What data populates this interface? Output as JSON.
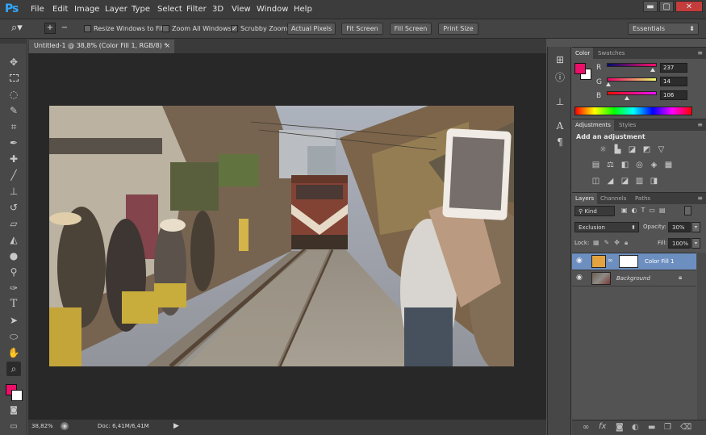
{
  "app": {
    "logo": "Ps"
  },
  "menu": [
    "File",
    "Edit",
    "Image",
    "Layer",
    "Type",
    "Select",
    "Filter",
    "3D",
    "View",
    "Window",
    "Help"
  ],
  "window_controls": {
    "minimize": "▬",
    "maximize": "▢",
    "close": "✕"
  },
  "options_bar": {
    "resize_windows_label": "Resize Windows to Fit",
    "resize_windows_checked": false,
    "zoom_all_label": "Zoom All Windows",
    "zoom_all_checked": false,
    "scrubby_zoom_label": "Scrubby Zoom",
    "scrubby_zoom_checked": true,
    "actual_pixels": "Actual Pixels",
    "fit_screen": "Fit Screen",
    "fill_screen": "Fill Screen",
    "print_size": "Print Size",
    "workspace": "Essentials"
  },
  "document": {
    "tab_title": "Untitled-1 @ 38,8% (Color Fill 1, RGB/8) *",
    "close_glyph": "×"
  },
  "status": {
    "zoom": "38,82%",
    "doc_info": "Doc: 6,41M/6,41M"
  },
  "colors": {
    "foreground": "#ed0e6a",
    "background": "#ffffff",
    "fill_swatch": "#e3a340",
    "accent": "#31a8ff"
  },
  "color_panel": {
    "tabs": [
      "Color",
      "Swatches"
    ],
    "r_label": "R",
    "r_value": "237",
    "g_label": "G",
    "g_value": "14",
    "b_label": "B",
    "b_value": "106"
  },
  "adjustments_panel": {
    "tabs": [
      "Adjustments",
      "Styles"
    ],
    "heading": "Add an adjustment"
  },
  "layers_panel": {
    "tabs": [
      "Layers",
      "Channels",
      "Paths"
    ],
    "filter_kind": "Kind",
    "blend_mode": "Exclusion",
    "opacity_label": "Opacity:",
    "opacity_value": "30%",
    "lock_label": "Lock:",
    "fill_label": "Fill:",
    "fill_value": "100%",
    "layers": [
      {
        "name": "Color Fill 1",
        "visible": true,
        "selected": true
      },
      {
        "name": "Background",
        "visible": true,
        "selected": false,
        "locked": true
      }
    ]
  }
}
